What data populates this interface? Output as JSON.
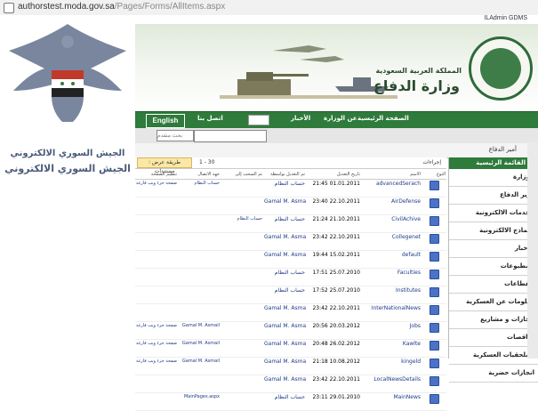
{
  "browser": {
    "url_host": "authorstest.moda.gov.sa",
    "url_path": "/Pages/Forms/AllItems.aspx"
  },
  "logo": {
    "caption1": "الجيش السوري الالكتروني",
    "caption2": "الجيش السوري الالكتروني"
  },
  "header": {
    "user": "ILAdmin GDMS",
    "subtitle": "المملكة العربية السعودية",
    "title": "وزارة الدفاع"
  },
  "nav": {
    "english": "English",
    "items": [
      "الصفحة الرئيسية",
      "عن الوزارة",
      "الأخبار",
      "اتصل بنا"
    ]
  },
  "search": {
    "placeholder": "بحث متقدم"
  },
  "breadcrumb": {
    "text": "أمير الدفاع"
  },
  "menu": {
    "heading": "القائمة الرئيسية",
    "items": [
      "الوزارة",
      "وزير الدفاع",
      "الخدمات الالكترونية",
      "النماذج الالكترونية",
      "الأخبار",
      "المطبوعات",
      "القطاعات",
      "معلومات عن العسكرية",
      "انجازات و مشاريع",
      "مناقصات",
      "الملحقيات العسكرية",
      "انجازات حضرية"
    ]
  },
  "toolbar": {
    "actions": "إجراءات",
    "view": "طريقة عرض : مستندات",
    "paging": "1 - 30"
  },
  "columns": [
    "النوع",
    "الاسم",
    "تاريخ التعديل",
    "تم التعديل بواسطة",
    "تم السحب إلى",
    "جهة الاتصال",
    "تنظيم الصفحة"
  ],
  "rows": [
    {
      "name": "advancedSerach",
      "date": "21:45 01.01.2011",
      "by": "حساب النظام",
      "checked": "",
      "contact": "حساب النظام",
      "layout": "صفحة جزء ويب فارغة"
    },
    {
      "name": "AirDefense",
      "date": "23:40 22.10.2011",
      "by": "Gamal M. Asmail",
      "checked": "",
      "contact": "",
      "layout": ""
    },
    {
      "name": "CivilAchive",
      "date": "21:24 21.10.2011",
      "by": "حساب النظام",
      "checked": "حساب النظام",
      "contact": "",
      "layout": ""
    },
    {
      "name": "Collegenet",
      "date": "23:42 22.10.2011",
      "by": "Gamal M. Asmail",
      "checked": "",
      "contact": "",
      "layout": ""
    },
    {
      "name": "default",
      "date": "19:44 15.02.2011",
      "by": "Gamal M. Asmail",
      "checked": "",
      "contact": "",
      "layout": ""
    },
    {
      "name": "Faculties",
      "date": "17:51 25.07.2010",
      "by": "حساب النظام",
      "checked": "",
      "contact": "",
      "layout": ""
    },
    {
      "name": "Institutes",
      "date": "17:52 25.07.2010",
      "by": "حساب النظام",
      "checked": "",
      "contact": "",
      "layout": ""
    },
    {
      "name": "InterNationalNews",
      "date": "23:42 22.10.2011",
      "by": "Gamal M. Asmail",
      "checked": "",
      "contact": "",
      "layout": ""
    },
    {
      "name": "Jobs",
      "date": "20:56 20.03.2012",
      "by": "Gamal M. Asmail",
      "checked": "",
      "contact": "Gamal M. Asmail",
      "layout": "صفحة جزء ويب فارغة"
    },
    {
      "name": "Kawlte",
      "date": "20:48 26.02.2012",
      "by": "Gamal M. Asmail",
      "checked": "",
      "contact": "Gamal M. Asmail",
      "layout": "صفحة جزء ويب فارغة"
    },
    {
      "name": "kingeld",
      "date": "21:18 10.08.2012",
      "by": "Gamal M. Asmail",
      "checked": "",
      "contact": "Gamal M. Asmail",
      "layout": "صفحة جزء ويب فارغة"
    },
    {
      "name": "LocalNewsDetails",
      "date": "23:42 22.10.2011",
      "by": "Gamal M. Asmail",
      "checked": "",
      "contact": "",
      "layout": ""
    },
    {
      "name": "MainNews",
      "date": "23:11 29.01.2010",
      "by": "حساب النظام",
      "checked": "",
      "contact": "MainPages.aspx",
      "layout": ""
    }
  ],
  "colors": {
    "green": "#2e7b3b",
    "link": "#1f3a8a"
  }
}
